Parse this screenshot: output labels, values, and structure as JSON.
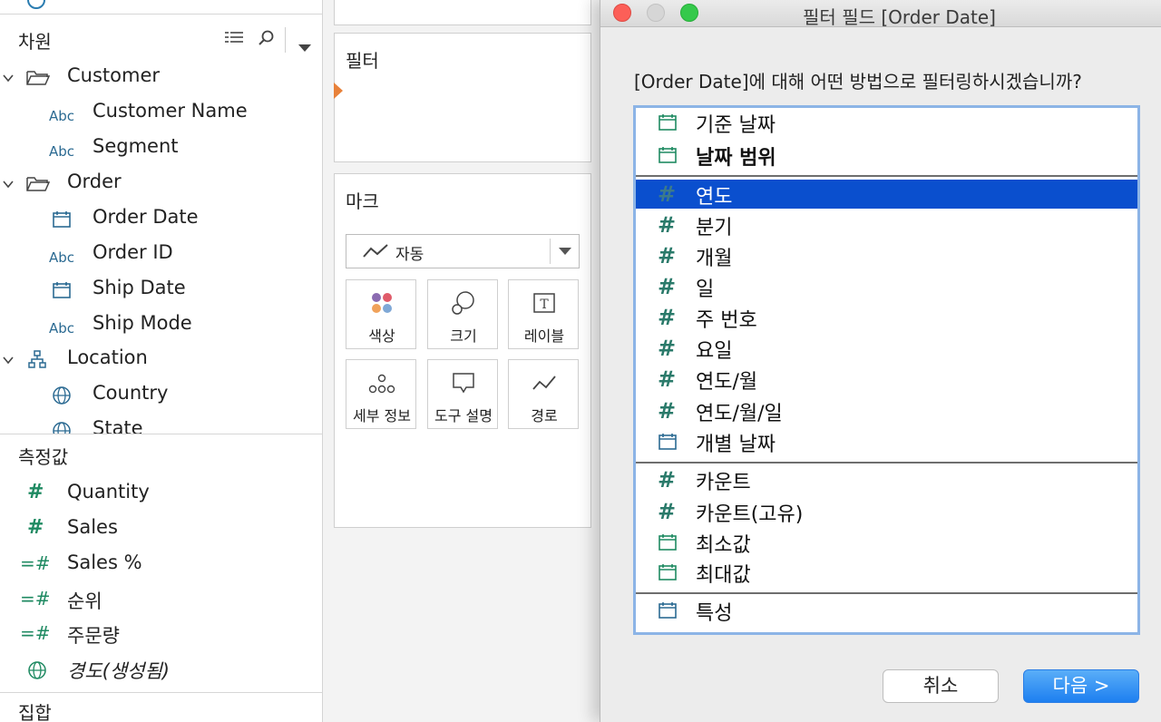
{
  "data_pane": {
    "dimensions_header": "차원",
    "dimensions": [
      {
        "type": "folder",
        "label": "Customer"
      },
      {
        "type": "abc",
        "label": "Customer Name"
      },
      {
        "type": "abc",
        "label": "Segment"
      },
      {
        "type": "folder",
        "label": "Order"
      },
      {
        "type": "calendar",
        "label": "Order Date"
      },
      {
        "type": "abc",
        "label": "Order ID"
      },
      {
        "type": "calendar",
        "label": "Ship Date"
      },
      {
        "type": "abc",
        "label": "Ship Mode"
      },
      {
        "type": "hierarchy",
        "label": "Location"
      },
      {
        "type": "globe",
        "label": "Country"
      },
      {
        "type": "globe",
        "label": "State"
      }
    ],
    "abc_badge": "Abc",
    "measures_header": "측정값",
    "measures": [
      {
        "type": "hash",
        "label": "Quantity"
      },
      {
        "type": "hash",
        "label": "Sales"
      },
      {
        "type": "calc-hash",
        "label": "Sales %"
      },
      {
        "type": "calc-hash",
        "label": "순위"
      },
      {
        "type": "calc-hash",
        "label": "주문량"
      },
      {
        "type": "globe",
        "label": "경도(생성됨)"
      }
    ],
    "sets_header": "집합"
  },
  "filters_panel": {
    "title": "필터"
  },
  "marks_panel": {
    "title": "마크",
    "mark_type": "자동",
    "buttons": [
      {
        "label": "색상",
        "icon": "color-icon"
      },
      {
        "label": "크기",
        "icon": "size-icon"
      },
      {
        "label": "레이블",
        "icon": "label-icon"
      },
      {
        "label": "세부 정보",
        "icon": "detail-icon"
      },
      {
        "label": "도구 설명",
        "icon": "tooltip-icon"
      },
      {
        "label": "경로",
        "icon": "path-icon"
      }
    ]
  },
  "dialog": {
    "title": "필터 필드 [Order Date]",
    "prompt": "[Order Date]에 대해 어떤 방법으로 필터링하시겠습니까?",
    "group1": [
      {
        "label": "기준 날짜",
        "icon": "calendar-icon"
      },
      {
        "label": "날짜 범위",
        "icon": "calendar-icon"
      }
    ],
    "group2": [
      {
        "label": "연도",
        "icon": "hash-icon",
        "selected": true
      },
      {
        "label": "분기",
        "icon": "hash-icon"
      },
      {
        "label": "개월",
        "icon": "hash-icon"
      },
      {
        "label": "일",
        "icon": "hash-icon"
      },
      {
        "label": "주 번호",
        "icon": "hash-icon"
      },
      {
        "label": "요일",
        "icon": "hash-icon"
      },
      {
        "label": "연도/월",
        "icon": "hash-icon"
      },
      {
        "label": "연도/월/일",
        "icon": "hash-icon"
      },
      {
        "label": "개별 날짜",
        "icon": "calendar-icon"
      }
    ],
    "group3": [
      {
        "label": "카운트",
        "icon": "hash-icon"
      },
      {
        "label": "카운트(고유)",
        "icon": "hash-icon"
      },
      {
        "label": "최소값",
        "icon": "calendar-icon"
      },
      {
        "label": "최대값",
        "icon": "calendar-icon"
      }
    ],
    "group4": [
      {
        "label": "특성",
        "icon": "calendar-icon"
      }
    ],
    "cancel_label": "취소",
    "next_label": "다음 >",
    "colors": {
      "selection": "#0a4fce",
      "primary_button": "#1d7ff0"
    }
  }
}
